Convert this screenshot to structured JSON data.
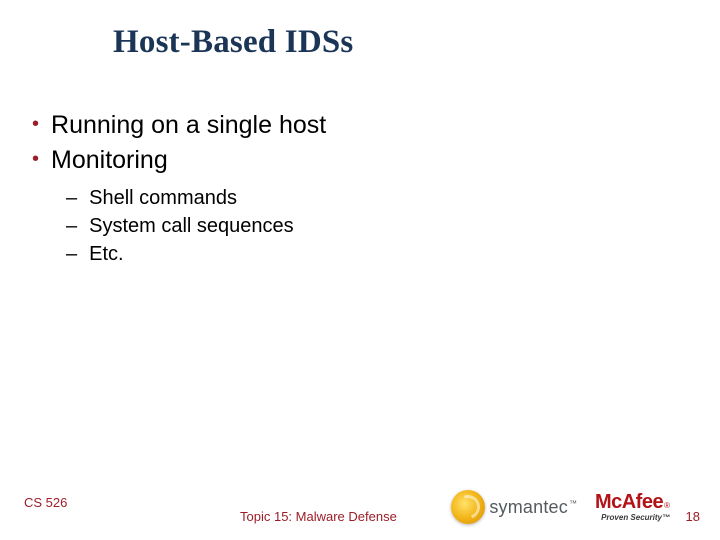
{
  "title": "Host-Based IDSs",
  "bullets": [
    {
      "text": "Running on a single host"
    },
    {
      "text": "Monitoring"
    }
  ],
  "subbullets": [
    {
      "text": "Shell commands"
    },
    {
      "text": "System call sequences"
    },
    {
      "text": "Etc."
    }
  ],
  "footer": {
    "course": "CS 526",
    "topic": "Topic 15: Malware Defense",
    "slidenum": "18"
  },
  "logos": {
    "symantec": "symantec",
    "symantec_tm": "™",
    "mcafee": "McAfee",
    "mcafee_r": "®",
    "mcafee_sub": "Proven Security™"
  }
}
